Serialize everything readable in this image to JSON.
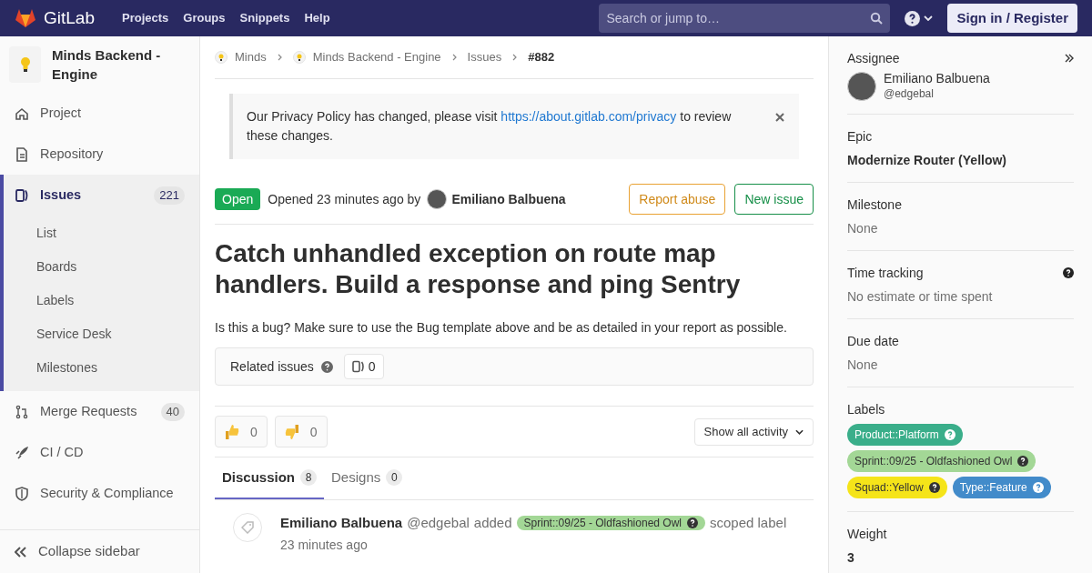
{
  "header": {
    "brand": "GitLab",
    "nav": [
      "Projects",
      "Groups",
      "Snippets",
      "Help"
    ],
    "search": {
      "placeholder": "Search or jump to…"
    },
    "sign_in": "Sign in / Register"
  },
  "sidebar": {
    "project": "Minds Backend - Engine",
    "items": [
      {
        "label": "Project",
        "selected": false
      },
      {
        "label": "Repository",
        "selected": false
      },
      {
        "label": "Issues",
        "selected": true,
        "count": "221",
        "children": [
          {
            "label": "List"
          },
          {
            "label": "Boards"
          },
          {
            "label": "Labels"
          },
          {
            "label": "Service Desk"
          },
          {
            "label": "Milestones"
          }
        ]
      },
      {
        "label": "Merge Requests",
        "selected": false,
        "count": "40"
      },
      {
        "label": "CI / CD",
        "selected": false
      },
      {
        "label": "Security & Compliance",
        "selected": false
      }
    ],
    "collapse": "Collapse sidebar"
  },
  "breadcrumbs": [
    {
      "label": "Minds",
      "avatar": true
    },
    {
      "label": "Minds Backend - Engine",
      "avatar": true
    },
    {
      "label": "Issues",
      "avatar": false
    },
    {
      "label": "#882",
      "avatar": false
    }
  ],
  "notice": {
    "text": "Our Privacy Policy has changed, please visit",
    "link": "https://about.gitlab.com/privacy",
    "after": "to review these changes."
  },
  "issue": {
    "status": "Open",
    "opened": "Opened 23 minutes ago by",
    "author": "Emiliano Balbuena",
    "report": "Report abuse",
    "new_issue": "New issue",
    "title": "Catch unhandled exception on route map handlers. Build a response and ping Sentry",
    "description": "Is this a bug? Make sure to use the Bug template above and be as detailed in your report as possible.",
    "related": {
      "label": "Related issues",
      "count": "0"
    },
    "reactions": [
      {
        "kind": "thumbsup",
        "count": "0"
      },
      {
        "kind": "thumbsdown",
        "count": "0"
      }
    ],
    "activity_filter": "Show all activity",
    "tabs": [
      {
        "label": "Discussion",
        "count": "8",
        "selected": true
      },
      {
        "label": "Designs",
        "count": "0",
        "selected": false
      }
    ],
    "events": [
      {
        "author": "Emiliano Balbuena",
        "handle": "@edgebal",
        "action": "added",
        "label": {
          "text": "Sprint::09/25 - Oldfashioned Owl",
          "color": "#a3d796"
        },
        "suffix": "scoped label",
        "time": "23 minutes ago"
      }
    ]
  },
  "right_sidebar": {
    "assignee": {
      "heading": "Assignee",
      "name": "Emiliano Balbuena",
      "handle": "@edgebal"
    },
    "epic": {
      "heading": "Epic",
      "value": "Modernize Router (Yellow)"
    },
    "milestone": {
      "heading": "Milestone",
      "value": "None"
    },
    "time_tracking": {
      "heading": "Time tracking",
      "value": "No estimate or time spent"
    },
    "due_date": {
      "heading": "Due date",
      "value": "None"
    },
    "labels": {
      "heading": "Labels",
      "items": [
        {
          "text": "Product::Platform",
          "color": "#3aae8a"
        },
        {
          "text": "Sprint::09/25 - Oldfashioned Owl",
          "color": "#a3d796"
        },
        {
          "text": "Squad::Yellow",
          "color": "#f5e419"
        },
        {
          "text": "Type::Feature",
          "color": "#428bca"
        }
      ]
    },
    "weight": {
      "heading": "Weight",
      "value": "3"
    }
  }
}
